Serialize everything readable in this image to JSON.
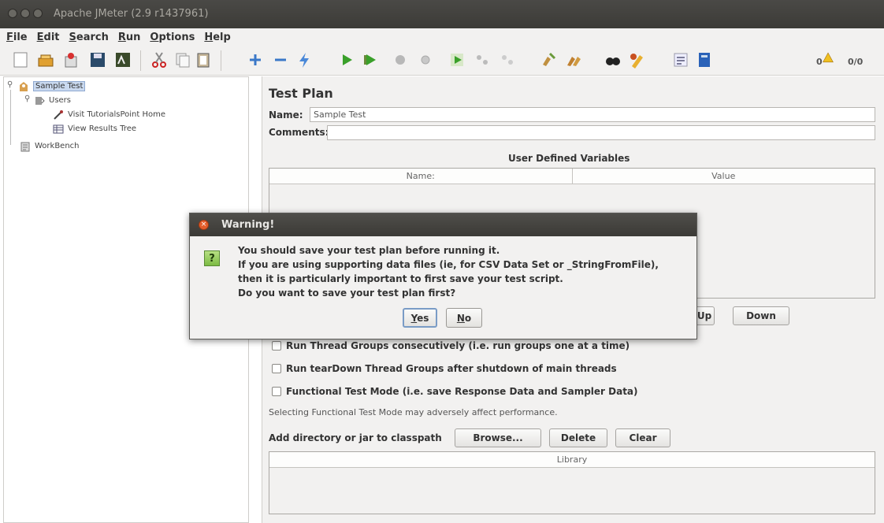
{
  "window": {
    "title": "Apache JMeter (2.9 r1437961)"
  },
  "menu": [
    "File",
    "Edit",
    "Search",
    "Run",
    "Options",
    "Help"
  ],
  "toolbar": {
    "icons": [
      "new-icon",
      "templates-icon",
      "open-icon",
      "save-icon",
      "save-as-icon",
      "cut-icon",
      "copy-icon",
      "paste-icon",
      "expand-icon",
      "collapse-icon",
      "toggle-icon",
      "start-icon",
      "start-no-pauses-icon",
      "stop-icon",
      "shutdown-icon",
      "remote-start-icon",
      "remote-stop-icon",
      "remote-shutdown-icon",
      "clear-icon",
      "clear-all-icon",
      "search-icon",
      "reset-search-icon",
      "function-helper-icon",
      "help-icon"
    ],
    "warnings_count": "0",
    "threads_ratio": "0/0"
  },
  "tree": {
    "nodes": [
      {
        "label": "Sample Test",
        "icon": "test-plan-icon",
        "selected": true
      },
      {
        "label": "Users",
        "icon": "thread-group-icon"
      },
      {
        "label": "Visit TutorialsPoint Home",
        "icon": "http-sampler-icon"
      },
      {
        "label": "View Results Tree",
        "icon": "results-tree-icon"
      },
      {
        "label": "WorkBench",
        "icon": "workbench-icon"
      }
    ]
  },
  "panel": {
    "title": "Test Plan",
    "name_label": "Name:",
    "name_value": "Sample Test",
    "comments_label": "Comments:",
    "comments_value": "",
    "udv_title": "User Defined Variables",
    "udv_columns": [
      "Name:",
      "Value"
    ],
    "udv_buttons": {
      "up": "Up",
      "down": "Down"
    },
    "checkboxes": [
      {
        "label": "Run Thread Groups consecutively (i.e. run groups one at a time)",
        "checked": false
      },
      {
        "label": "Run tearDown Thread Groups after shutdown of main threads",
        "checked": false
      },
      {
        "label": "Functional Test Mode (i.e. save Response Data and Sampler Data)",
        "checked": false
      }
    ],
    "functional_note": "Selecting Functional Test Mode may adversely affect performance.",
    "classpath_label": "Add directory or jar to classpath",
    "classpath_buttons": {
      "browse": "Browse...",
      "delete": "Delete",
      "clear": "Clear"
    },
    "library_column": "Library"
  },
  "dialog": {
    "title": "Warning!",
    "lines": [
      "You should save your test plan before running it.",
      "If you are using supporting data files (ie, for CSV Data Set or _StringFromFile),",
      "then it is particularly important to first save your test script.",
      "Do you want to save your test plan first?"
    ],
    "yes_label": "Yes",
    "no_label": "No"
  },
  "colors": {
    "accent": "#7a9cc6",
    "selection": "#c9d9ef",
    "dialog_close": "#e35d2b",
    "question_icon": "#7cbb43"
  }
}
